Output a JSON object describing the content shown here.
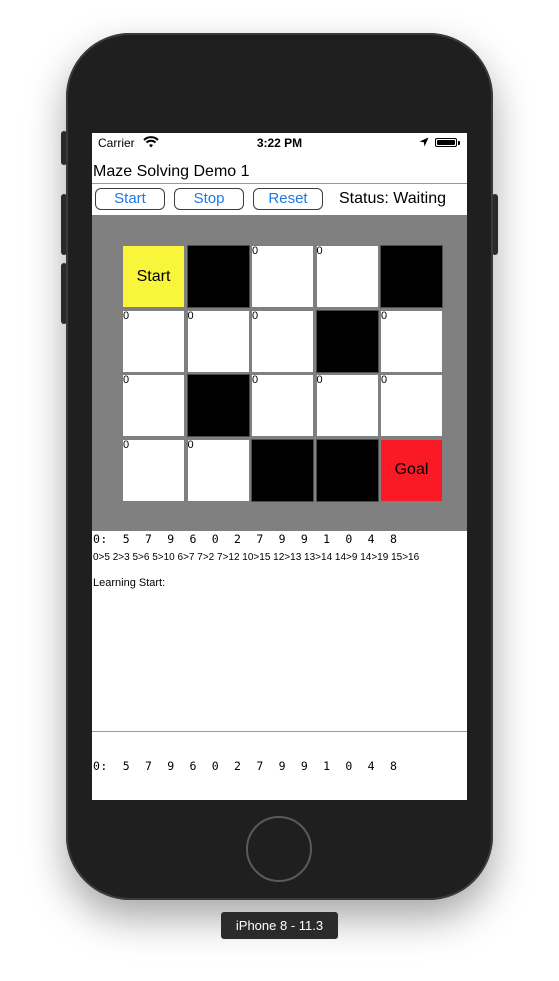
{
  "statusbar": {
    "carrier": "Carrier",
    "time": "3:22 PM"
  },
  "app": {
    "title": "Maze Solving Demo 1",
    "buttons": {
      "start": "Start",
      "stop": "Stop",
      "reset": "Reset"
    },
    "status": "Status: Waiting"
  },
  "maze": {
    "rows": [
      [
        {
          "type": "start",
          "text": "Start"
        },
        {
          "type": "wall",
          "text": ""
        },
        {
          "type": "open",
          "text": "0"
        },
        {
          "type": "open",
          "text": "0"
        },
        {
          "type": "wall",
          "text": ""
        }
      ],
      [
        {
          "type": "open",
          "text": "0"
        },
        {
          "type": "open",
          "text": "0"
        },
        {
          "type": "open",
          "text": "0"
        },
        {
          "type": "wall",
          "text": ""
        },
        {
          "type": "open",
          "text": "0"
        }
      ],
      [
        {
          "type": "open",
          "text": "0"
        },
        {
          "type": "wall",
          "text": ""
        },
        {
          "type": "open",
          "text": "0"
        },
        {
          "type": "open",
          "text": "0"
        },
        {
          "type": "open",
          "text": "0"
        }
      ],
      [
        {
          "type": "open",
          "text": "0"
        },
        {
          "type": "open",
          "text": "0"
        },
        {
          "type": "wall",
          "text": ""
        },
        {
          "type": "wall",
          "text": ""
        },
        {
          "type": "goal",
          "text": "Goal"
        }
      ]
    ]
  },
  "output": {
    "path_line": "0:  5  7  9  6  0  2  7  9  9  1  0  4  8",
    "moves_line": "0>5 2>3 5>6 5>10 6>7 7>2 7>12 10>15 12>13 13>14 14>9 14>19 15>16",
    "log_label": "Learning Start:",
    "bottom_path": "0:  5  7  9  6  0  2  7  9  9  1  0  4  8"
  },
  "device_label": "iPhone 8 - 11.3",
  "colors": {
    "start": "#f9f53a",
    "goal": "#f91a26",
    "wall": "#000000",
    "maze_background": "#808080",
    "button_text": "#1e7ae6"
  }
}
